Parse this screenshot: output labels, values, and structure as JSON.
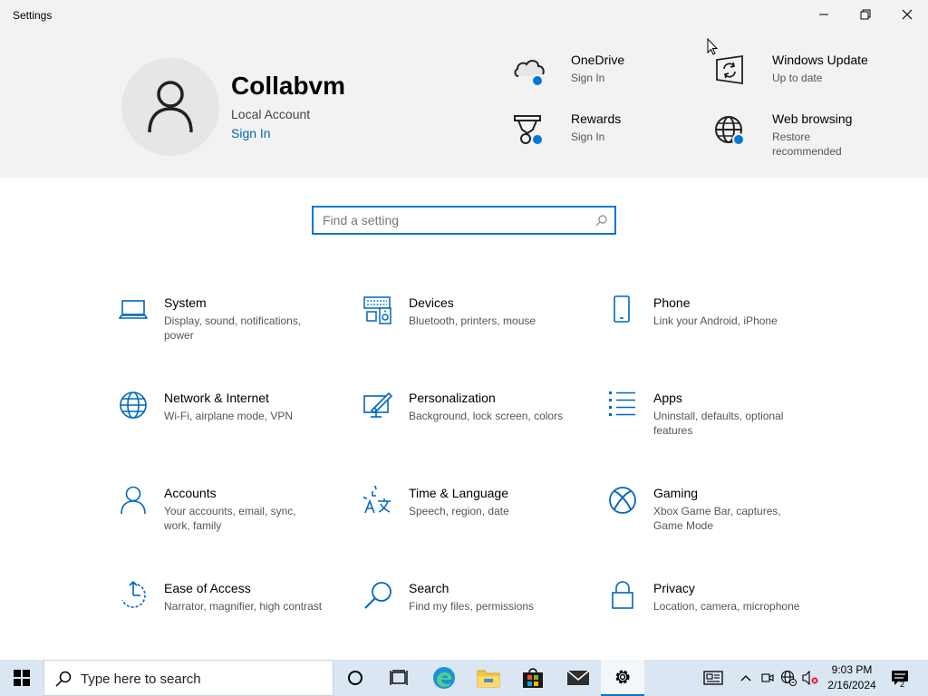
{
  "window": {
    "title": "Settings"
  },
  "profile": {
    "name": "Collabvm",
    "account_type": "Local Account",
    "sign_in": "Sign In"
  },
  "quick_items": [
    {
      "title": "OneDrive",
      "subtitle": "Sign In",
      "icon": "onedrive-cloud-icon"
    },
    {
      "title": "Windows Update",
      "subtitle": "Up to date",
      "icon": "windows-update-icon"
    },
    {
      "title": "Rewards",
      "subtitle": "Sign In",
      "icon": "rewards-trophy-icon"
    },
    {
      "title": "Web browsing",
      "subtitle": "Restore recommended",
      "icon": "globe-icon"
    }
  ],
  "search": {
    "placeholder": "Find a setting"
  },
  "categories": [
    {
      "title": "System",
      "description": "Display, sound, notifications, power",
      "icon": "laptop-icon"
    },
    {
      "title": "Devices",
      "description": "Bluetooth, printers, mouse",
      "icon": "keyboard-speaker-icon"
    },
    {
      "title": "Phone",
      "description": "Link your Android, iPhone",
      "icon": "phone-icon"
    },
    {
      "title": "Network & Internet",
      "description": "Wi-Fi, airplane mode, VPN",
      "icon": "globe-icon"
    },
    {
      "title": "Personalization",
      "description": "Background, lock screen, colors",
      "icon": "paintbrush-monitor-icon"
    },
    {
      "title": "Apps",
      "description": "Uninstall, defaults, optional features",
      "icon": "app-list-icon"
    },
    {
      "title": "Accounts",
      "description": "Your accounts, email, sync, work, family",
      "icon": "person-icon"
    },
    {
      "title": "Time & Language",
      "description": "Speech, region, date",
      "icon": "time-language-icon"
    },
    {
      "title": "Gaming",
      "description": "Xbox Game Bar, captures, Game Mode",
      "icon": "xbox-icon"
    },
    {
      "title": "Ease of Access",
      "description": "Narrator, magnifier, high contrast",
      "icon": "ease-of-access-icon"
    },
    {
      "title": "Search",
      "description": "Find my files, permissions",
      "icon": "magnifier-icon"
    },
    {
      "title": "Privacy",
      "description": "Location, camera, microphone",
      "icon": "lock-icon"
    }
  ],
  "taskbar": {
    "search_text": "Type here to search",
    "time": "9:03 PM",
    "date": "2/16/2024",
    "notification_count": "2"
  },
  "colors": {
    "accent": "#0078d7",
    "header_bg": "#f2f2f2",
    "taskbar_bg": "#dbe6f3",
    "link": "#0066b4"
  }
}
